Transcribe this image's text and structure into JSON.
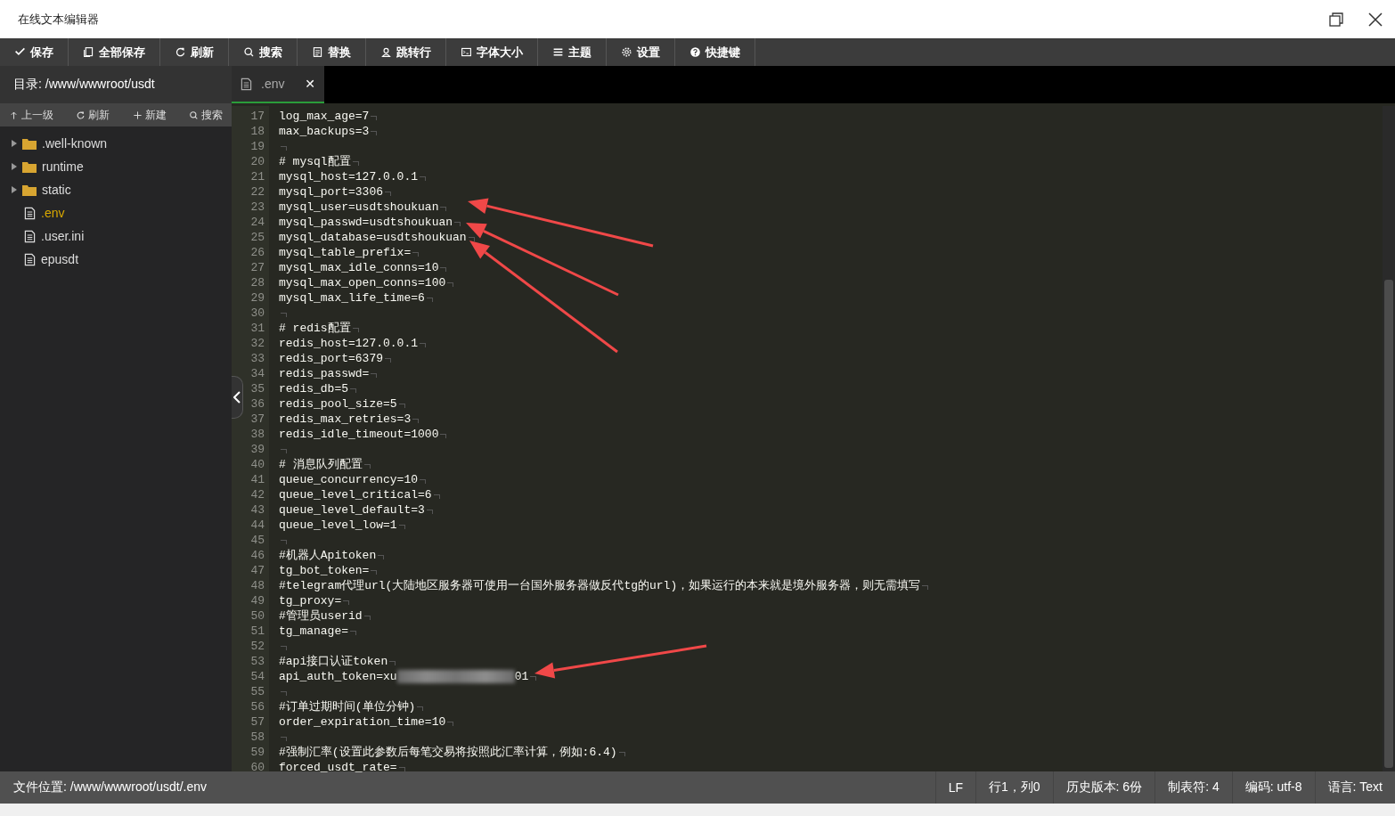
{
  "window": {
    "title": "在线文本编辑器"
  },
  "toolbar": [
    {
      "label": "保存"
    },
    {
      "label": "全部保存"
    },
    {
      "label": "刷新"
    },
    {
      "label": "搜索"
    },
    {
      "label": "替换"
    },
    {
      "label": "跳转行"
    },
    {
      "label": "字体大小"
    },
    {
      "label": "主题"
    },
    {
      "label": "设置"
    },
    {
      "label": "快捷键"
    }
  ],
  "sidebar": {
    "path": "目录: /www/wwwroot/usdt",
    "actions": [
      {
        "label": "上一级"
      },
      {
        "label": "刷新"
      },
      {
        "label": "新建"
      },
      {
        "label": "搜索"
      }
    ],
    "items": [
      {
        "kind": "folder",
        "name": ".well-known",
        "selected": false
      },
      {
        "kind": "folder",
        "name": "runtime",
        "selected": false
      },
      {
        "kind": "folder",
        "name": "static",
        "selected": false
      },
      {
        "kind": "file",
        "name": ".env",
        "selected": true
      },
      {
        "kind": "file",
        "name": ".user.ini",
        "selected": false
      },
      {
        "kind": "file",
        "name": "epusdt",
        "selected": false
      }
    ]
  },
  "tabs": [
    {
      "label": ".env",
      "selected": true,
      "close": "✕"
    }
  ],
  "editor": {
    "show_invisibles": true,
    "lines": [
      {
        "n": "17",
        "text": "log_max_age=7"
      },
      {
        "n": "18",
        "text": "max_backups=3"
      },
      {
        "n": "19"
      },
      {
        "n": "20",
        "text": "# mysql配置"
      },
      {
        "n": "21",
        "text": "mysql_host=127.0.0.1"
      },
      {
        "n": "22",
        "text": "mysql_port=3306"
      },
      {
        "n": "23",
        "text": "mysql_user=usdtshoukuan"
      },
      {
        "n": "24",
        "text": "mysql_passwd=usdtshoukuan"
      },
      {
        "n": "25",
        "text": "mysql_database=usdtshoukuan"
      },
      {
        "n": "26",
        "text": "mysql_table_prefix="
      },
      {
        "n": "27",
        "text": "mysql_max_idle_conns=10"
      },
      {
        "n": "28",
        "text": "mysql_max_open_conns=100"
      },
      {
        "n": "29",
        "text": "mysql_max_life_time=6"
      },
      {
        "n": "30"
      },
      {
        "n": "31",
        "text": "# redis配置"
      },
      {
        "n": "32",
        "text": "redis_host=127.0.0.1"
      },
      {
        "n": "33",
        "text": "redis_port=6379"
      },
      {
        "n": "34",
        "text": "redis_passwd="
      },
      {
        "n": "35",
        "text": "redis_db=5"
      },
      {
        "n": "36",
        "text": "redis_pool_size=5"
      },
      {
        "n": "37",
        "text": "redis_max_retries=3"
      },
      {
        "n": "38",
        "text": "redis_idle_timeout=1000"
      },
      {
        "n": "39"
      },
      {
        "n": "40",
        "text": "# 消息队列配置"
      },
      {
        "n": "41",
        "text": "queue_concurrency=10"
      },
      {
        "n": "42",
        "text": "queue_level_critical=6"
      },
      {
        "n": "43",
        "text": "queue_level_default=3"
      },
      {
        "n": "44",
        "text": "queue_level_low=1"
      },
      {
        "n": "45"
      },
      {
        "n": "46",
        "text": "#机器人Apitoken"
      },
      {
        "n": "47",
        "text": "tg_bot_token="
      },
      {
        "n": "48",
        "text": "#telegram代理url(大陆地区服务器可使用一台国外服务器做反代tg的url)，如果运行的本来就是境外服务器，则无需填写"
      },
      {
        "n": "49",
        "text": "tg_proxy="
      },
      {
        "n": "50",
        "text": "#管理员userid"
      },
      {
        "n": "51",
        "text": "tg_manage="
      },
      {
        "n": "52"
      },
      {
        "n": "53",
        "text": "#api接口认证token"
      },
      {
        "n": "54",
        "text": "api_auth_token=xu",
        "redacted": true,
        "tail": "01"
      },
      {
        "n": "55"
      },
      {
        "n": "56",
        "text": "#订单过期时间(单位分钟)"
      },
      {
        "n": "57",
        "text": "order_expiration_time=10"
      },
      {
        "n": "58"
      },
      {
        "n": "59",
        "text": "#强制汇率(设置此参数后每笔交易将按照此汇率计算，例如:6.4)"
      },
      {
        "n": "60",
        "text": "forced_usdt_rate="
      }
    ]
  },
  "status_bar": {
    "file": "文件位置: /www/wwwroot/usdt/.env",
    "items": [
      "LF",
      "行1，列0",
      "历史版本: 6份",
      "制表符: 4",
      "编码: utf-8",
      "语言: Text"
    ]
  }
}
